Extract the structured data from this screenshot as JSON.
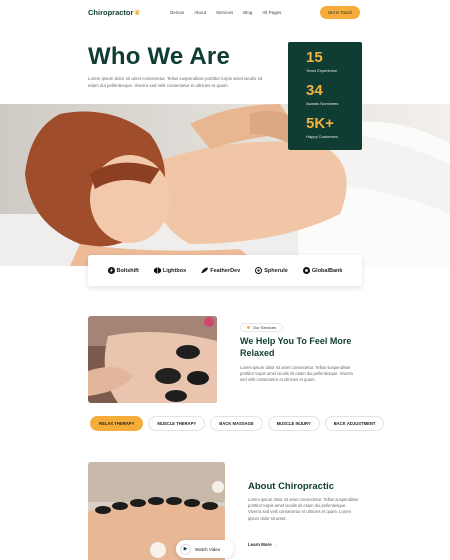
{
  "nav": {
    "logo": "Chiropractor",
    "links": [
      "Demos",
      "About",
      "Services",
      "Blog",
      "All Pages"
    ],
    "cta": "Get in Touch"
  },
  "hero": {
    "title": "Who We Are",
    "text": "Lorem ipsum dolor sit amet consectetur. Tellus suspendisse porttitor turpis amet iaculis sit etiam dui pellentesque. Viverra sed velit consectetur et ultricies et quam."
  },
  "stats": [
    {
      "value": "15",
      "label": "Years Experience"
    },
    {
      "value": "34",
      "label": "Awards Nominees"
    },
    {
      "value": "5K+",
      "label": "Happy Customers"
    }
  ],
  "brands": [
    "Boltshift",
    "Lightbox",
    "FeatherDev",
    "Spherule",
    "GlobalBank"
  ],
  "services": {
    "tag": "Our Services",
    "title": "We Help You To Feel More Relaxed",
    "text": "Lorem ipsum dolor sit amet consectetur. Tellus suspendisse porttitor turpis amet iaculis sit etiam dui pellentesque. Viverra sed velit consectetur et ultricies et quam."
  },
  "tabs": [
    "RELAX THERAPY",
    "MUSCLE THERAPY",
    "BACK MASSAGE",
    "MUSCLE INJURY",
    "BACK ADJUSTMENT"
  ],
  "about": {
    "title": "About Chiropractic",
    "text": "Lorem ipsum dolor sit amet consectetur. Tellus suspendisse porttitor turpis amet iaculis sit etiam dui pellentesque. Viverra sed velit consectetur et ultricies et quam. Lorem ipsum dolor sit amet.",
    "link": "Learn More",
    "watch": "Watch Video"
  },
  "colors": {
    "primary": "#0f3d33",
    "accent": "#f5ac3a"
  }
}
